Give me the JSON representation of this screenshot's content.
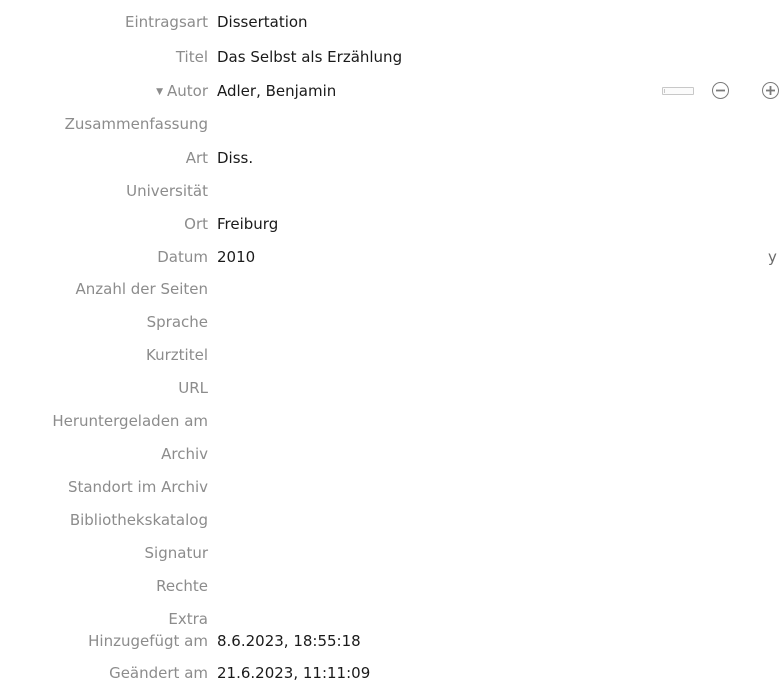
{
  "fields": [
    {
      "key": "item_type",
      "label": "Eintragsart",
      "value": "Dissertation"
    },
    {
      "key": "title",
      "label": "Titel",
      "value": "Das Selbst als Erzählung"
    },
    {
      "key": "author",
      "label": "Autor",
      "value": "Adler, Benjamin"
    },
    {
      "key": "abstract",
      "label": "Zusammenfassung",
      "value": ""
    },
    {
      "key": "type",
      "label": "Art",
      "value": "Diss."
    },
    {
      "key": "university",
      "label": "Universität",
      "value": ""
    },
    {
      "key": "place",
      "label": "Ort",
      "value": "Freiburg"
    },
    {
      "key": "date",
      "label": "Datum",
      "value": "2010"
    },
    {
      "key": "num_pages",
      "label": "Anzahl der Seiten",
      "value": ""
    },
    {
      "key": "language",
      "label": "Sprache",
      "value": ""
    },
    {
      "key": "short_title",
      "label": "Kurztitel",
      "value": ""
    },
    {
      "key": "url",
      "label": "URL",
      "value": ""
    },
    {
      "key": "accessed",
      "label": "Heruntergeladen am",
      "value": ""
    },
    {
      "key": "archive",
      "label": "Archiv",
      "value": ""
    },
    {
      "key": "archive_location",
      "label": "Standort im Archiv",
      "value": ""
    },
    {
      "key": "library_catalog",
      "label": "Bibliothekskatalog",
      "value": ""
    },
    {
      "key": "call_number",
      "label": "Signatur",
      "value": ""
    },
    {
      "key": "rights",
      "label": "Rechte",
      "value": ""
    },
    {
      "key": "extra",
      "label": "Extra",
      "value": ""
    },
    {
      "key": "date_added",
      "label": "Hinzugefügt am",
      "value": "8.6.2023, 18:55:18"
    },
    {
      "key": "date_modified",
      "label": "Geändert am",
      "value": "21.6.2023, 11:11:09"
    }
  ],
  "date_marker": "y",
  "icons": {
    "author_twisty": "triangle-down-icon",
    "remove_creator": "minus-circle-icon",
    "add_creator": "plus-circle-icon"
  }
}
